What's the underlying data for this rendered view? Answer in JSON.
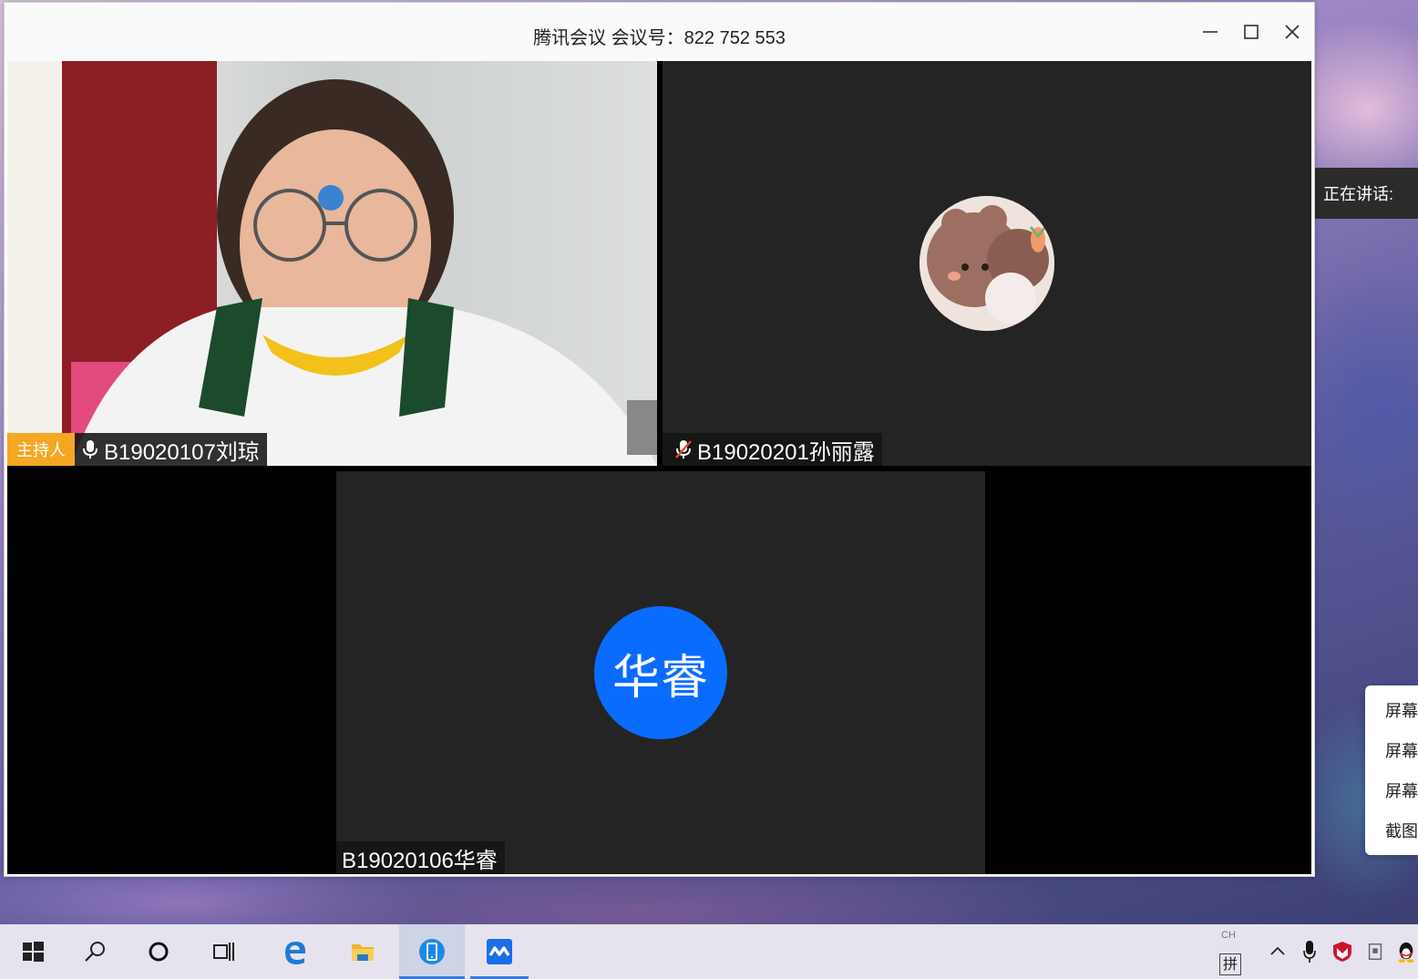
{
  "window": {
    "title": "腾讯会议 会议号：822 752 553"
  },
  "participants": [
    {
      "name": "B19020107刘琼",
      "badge": "主持人",
      "mic": "on",
      "video": true
    },
    {
      "name": "B19020201孙丽露",
      "mic": "muted",
      "video": false,
      "avatar": "cartoon-bear-avatar"
    },
    {
      "name": "B19020106华睿",
      "mic": "none",
      "video": false,
      "avatar_text": "华睿"
    }
  ],
  "speaking": {
    "label": "正在讲话:"
  },
  "screenshot_menu": {
    "items": [
      "屏幕",
      "屏幕",
      "屏幕",
      "截图"
    ]
  },
  "taskbar": {
    "ime_mode": "CH",
    "ime_input": "拼",
    "accent_color": "#3a7bd5"
  },
  "colors": {
    "host_badge": "#f5a623",
    "avatar_bg": "#0a6cff",
    "tile_bg": "#242424"
  }
}
